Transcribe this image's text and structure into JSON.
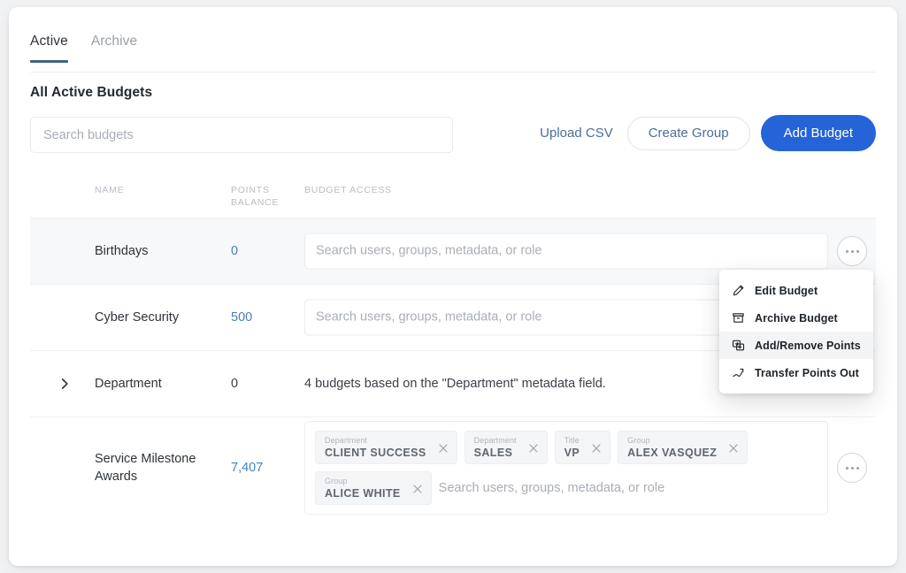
{
  "tabs": [
    {
      "label": "Active",
      "active": true
    },
    {
      "label": "Archive",
      "active": false
    }
  ],
  "section": {
    "title": "All Active Budgets"
  },
  "toolbar": {
    "search_placeholder": "Search budgets",
    "search_value": "",
    "upload_csv_label": "Upload CSV",
    "create_group_label": "Create Group",
    "add_budget_label": "Add Budget"
  },
  "table": {
    "columns": {
      "name": "NAME",
      "points_line1": "POINTS",
      "points_line2": "BALANCE",
      "access": "BUDGET ACCESS"
    },
    "access_placeholder": "Search users, groups, metadata, or role",
    "rows": [
      {
        "name": "Birthdays",
        "points": "0",
        "points_style": "link",
        "access_type": "input",
        "chips": [],
        "highlight": true,
        "has_chevron": false,
        "has_more": true
      },
      {
        "name": "Cyber Security",
        "points": "500",
        "points_style": "link",
        "access_type": "input",
        "chips": [],
        "highlight": false,
        "has_chevron": false,
        "has_more": true
      },
      {
        "name": "Department",
        "points": "0",
        "points_style": "plain",
        "access_type": "text",
        "access_text": "4 budgets based on the \"Department\" metadata field.",
        "chips": [],
        "highlight": false,
        "has_chevron": true,
        "has_more": false
      },
      {
        "name": "Service Milestone Awards",
        "points": "7,407",
        "points_style": "link",
        "access_type": "chips",
        "chips": [
          {
            "category": "Department",
            "value": "CLIENT SUCCESS"
          },
          {
            "category": "Department",
            "value": "SALES"
          },
          {
            "category": "Title",
            "value": "VP"
          },
          {
            "category": "Group",
            "value": "ALEX VASQUEZ"
          },
          {
            "category": "Group",
            "value": "ALICE WHITE"
          }
        ],
        "highlight": false,
        "has_chevron": false,
        "has_more": true
      }
    ]
  },
  "context_menu": {
    "open": true,
    "items": [
      {
        "label": "Edit Budget",
        "icon": "pencil-icon",
        "active": false
      },
      {
        "label": "Archive Budget",
        "icon": "archive-icon",
        "active": false
      },
      {
        "label": "Add/Remove Points",
        "icon": "swap-icon",
        "active": true
      },
      {
        "label": "Transfer Points Out",
        "icon": "trend-arrow-icon",
        "active": false
      }
    ]
  },
  "colors": {
    "primary": "#2563d9",
    "link": "#4a6f99",
    "tab_underline": "#41637e",
    "points_link": "#4a7fc1",
    "page_bg": "#f1f2f4"
  }
}
